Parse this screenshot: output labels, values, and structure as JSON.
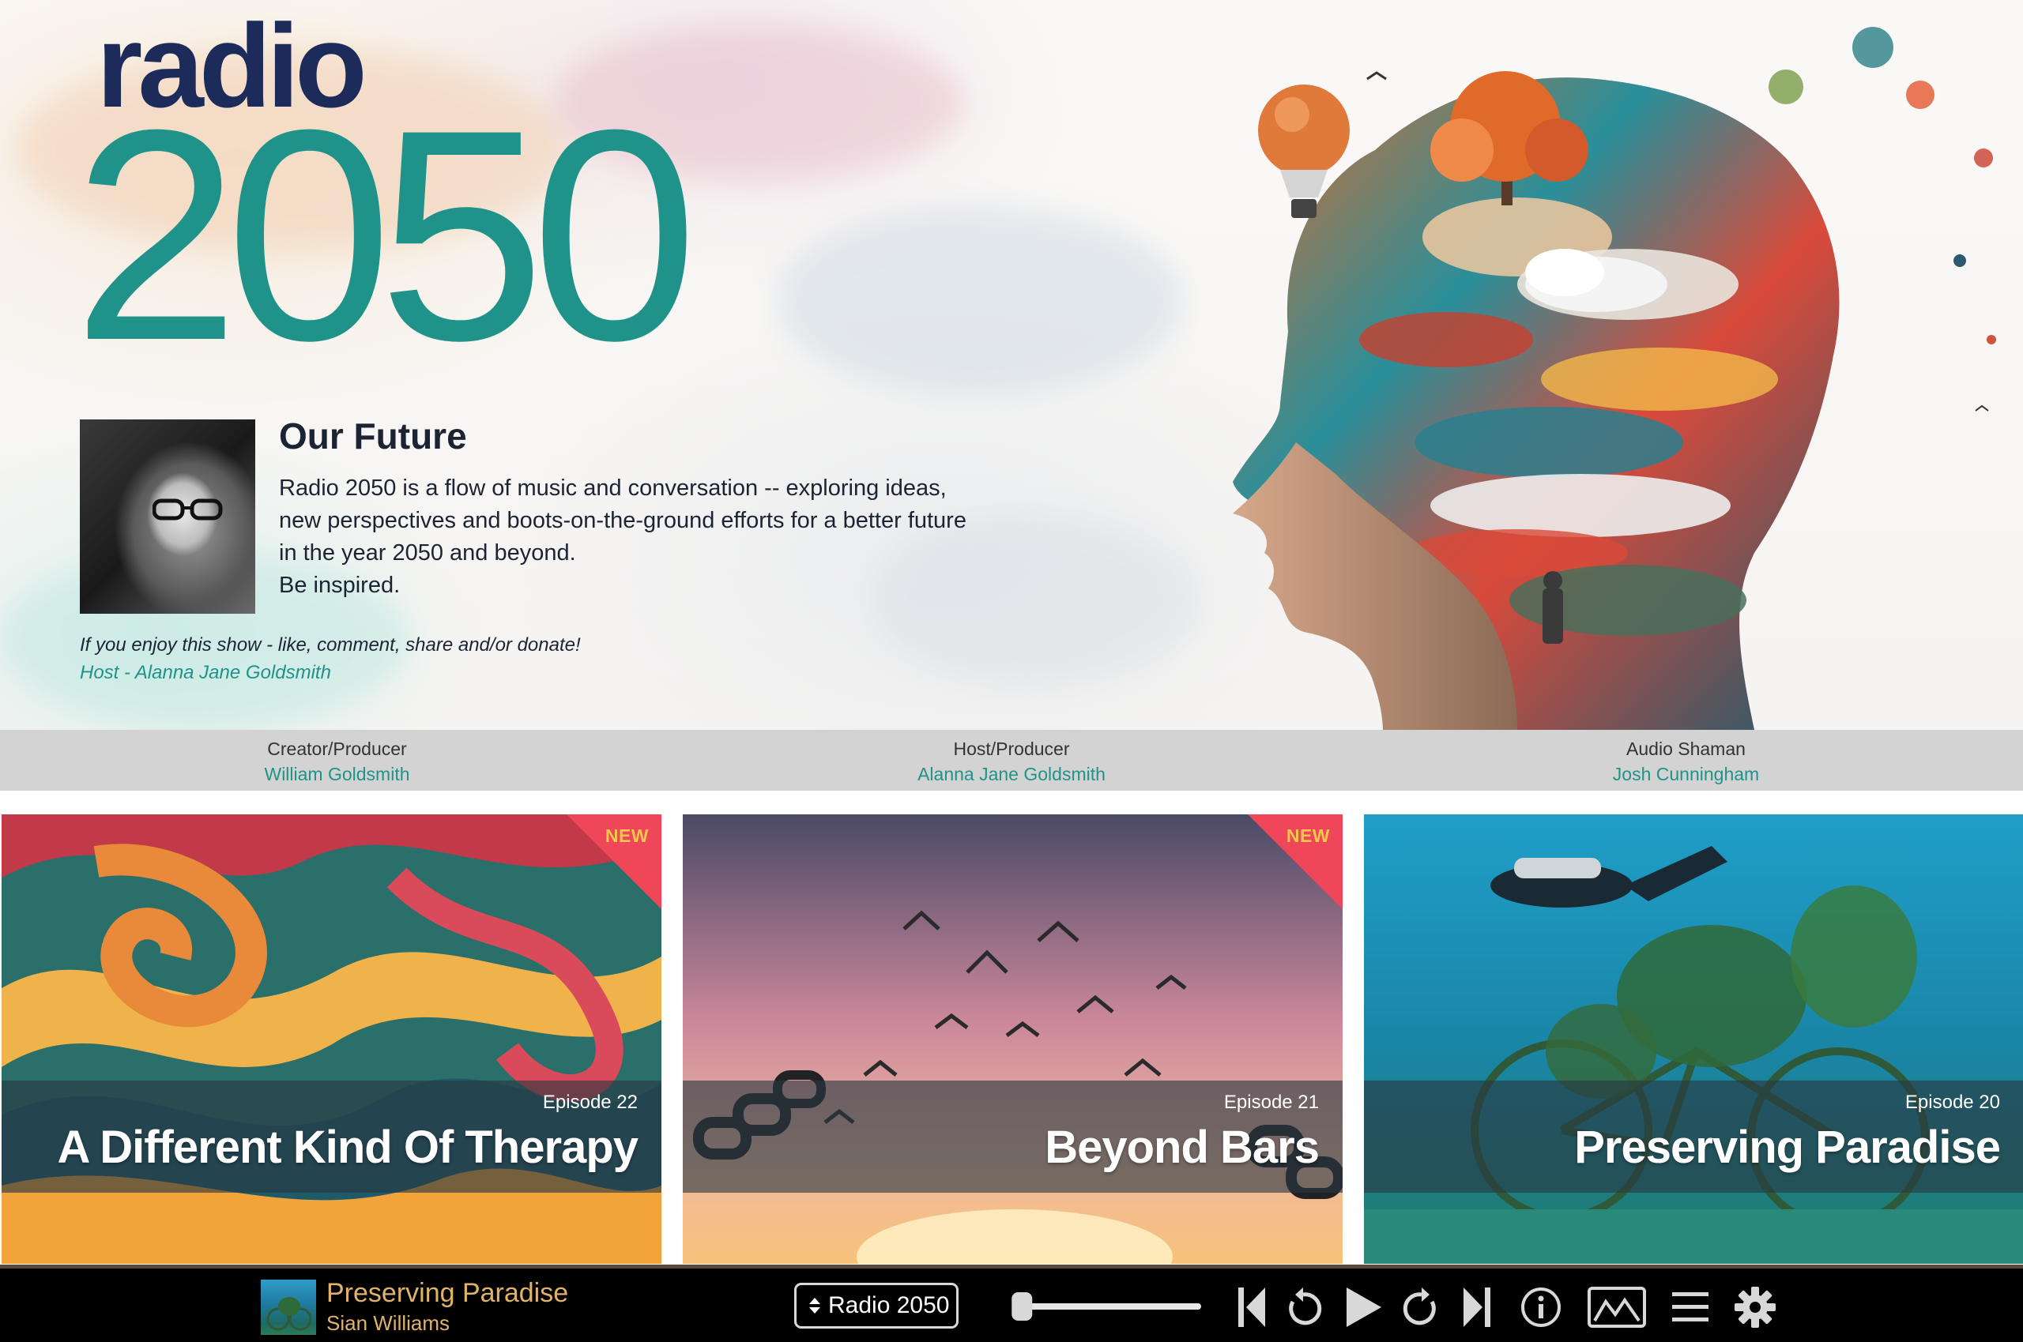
{
  "brand": {
    "logo_word": "radio",
    "logo_year": "2050",
    "colors": {
      "navy": "#1d2b5a",
      "teal": "#1f938a",
      "gold": "#e0b26a",
      "new_ribbon": "#f0465a"
    }
  },
  "intro": {
    "title": "Our Future",
    "paragraph_lines": [
      "Radio 2050 is a flow of music and conversation -- exploring ideas,",
      "new perspectives and boots-on-the-ground efforts for a better future",
      "in the year 2050 and beyond.",
      "Be inspired."
    ],
    "cta": "If you enjoy this show - like, comment, share and/or donate!",
    "host_credit": "Host - Alanna Jane Goldsmith"
  },
  "credits": [
    {
      "role": "Creator/Producer",
      "name": "William Goldsmith"
    },
    {
      "role": "Host/Producer",
      "name": "Alanna Jane Goldsmith"
    },
    {
      "role": "Audio Shaman",
      "name": "Josh Cunningham"
    }
  ],
  "episodes": [
    {
      "episode": "Episode 22",
      "title": "A Different Kind Of Therapy",
      "badge": "NEW"
    },
    {
      "episode": "Episode 21",
      "title": "Beyond Bars",
      "badge": "NEW"
    },
    {
      "episode": "Episode 20",
      "title": "Preserving Paradise",
      "badge": ""
    }
  ],
  "player": {
    "now_playing_title": "Preserving Paradise",
    "now_playing_artist": "Sian Williams",
    "station_label": "Radio 2050",
    "volume_level": 0.05,
    "icons": [
      "previous-icon",
      "rewind-icon",
      "play-icon",
      "forward-icon",
      "next-icon",
      "info-icon",
      "artwork-icon",
      "menu-icon",
      "settings-icon"
    ]
  }
}
